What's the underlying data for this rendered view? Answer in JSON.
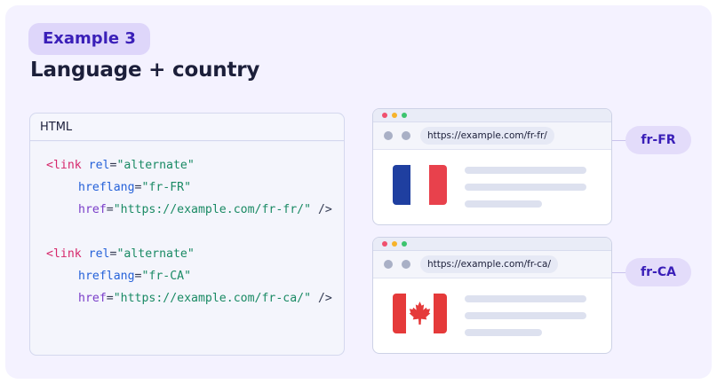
{
  "badge": "Example 3",
  "title": "Language + country",
  "code": {
    "header": "HTML",
    "blocks": [
      {
        "open": "<link",
        "rel_attr": "rel",
        "rel_eq": "=",
        "rel_val": "\"alternate\"",
        "hreflang_attr": "hreflang",
        "hreflang_eq": "=",
        "hreflang_val": "\"fr-FR\"",
        "href_attr": "href",
        "href_eq": "=",
        "href_val": "\"https://example.com/fr-fr/\"",
        "close": "/>"
      },
      {
        "open": "<link",
        "rel_attr": "rel",
        "rel_eq": "=",
        "rel_val": "\"alternate\"",
        "hreflang_attr": "hreflang",
        "hreflang_eq": "=",
        "hreflang_val": "\"fr-CA\"",
        "href_attr": "href",
        "href_eq": "=",
        "href_val": "\"https://example.com/fr-ca/\"",
        "close": "/>"
      }
    ]
  },
  "browsers": [
    {
      "url": "https://example.com/fr-fr/",
      "flag_icon": "france-flag-icon",
      "label": "fr-FR"
    },
    {
      "url": "https://example.com/fr-ca/",
      "flag_icon": "canada-flag-icon",
      "label": "fr-CA"
    }
  ],
  "colors": {
    "background": "#f4f2ff",
    "badge_bg": "#ded6fa",
    "accent": "#3a1fb8",
    "tag": "#d6286b",
    "attribute": "#2662d9",
    "string": "#1a8a64",
    "france_blue": "#1f3fa0",
    "france_red": "#e8414c",
    "canada_red": "#e53a3a"
  }
}
